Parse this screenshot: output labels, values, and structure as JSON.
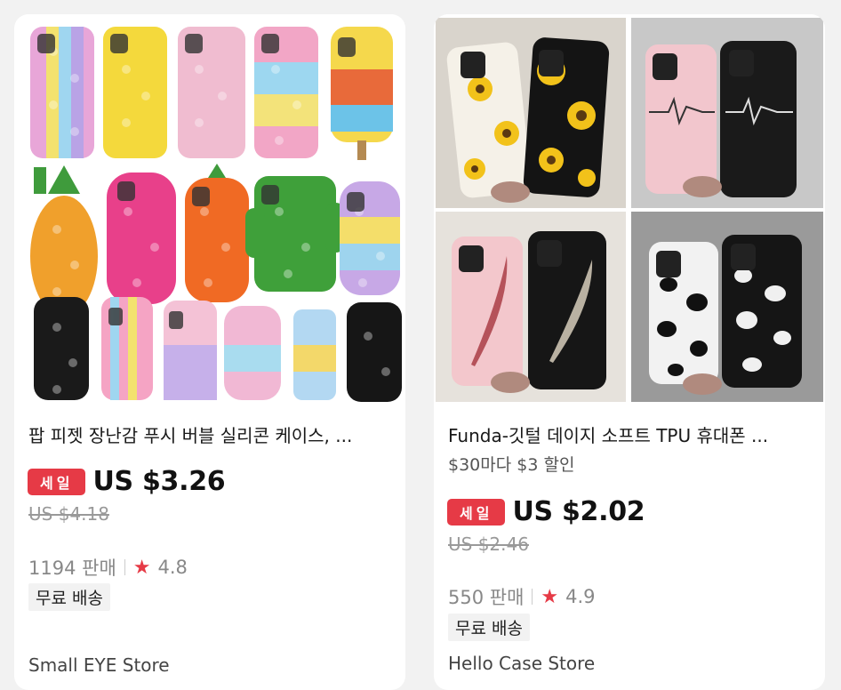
{
  "products": [
    {
      "title": "팝 피젯 장난감 푸시 버블 실리콘 케이스, ...",
      "sale_badge": "세일",
      "price": "US $3.26",
      "original_price": "US $4.18",
      "sold": "1194 판매",
      "rating": "4.8",
      "shipping": "무료 배송",
      "store": "Small EYE Store",
      "image_icon": "fidget-phone-cases-image"
    },
    {
      "title": "Funda-깃털 데이지 소프트 TPU 휴대폰 ...",
      "promo": "$30마다 $3 할인",
      "sale_badge": "세일",
      "price": "US $2.02",
      "original_price": "US $2.46",
      "sold": "550 판매",
      "rating": "4.9",
      "shipping": "무료 배송",
      "store": "Hello Case Store",
      "image_icon": "printed-phone-cases-image"
    }
  ],
  "colors": {
    "accent": "#e63a46",
    "background": "#f2f2f2"
  }
}
